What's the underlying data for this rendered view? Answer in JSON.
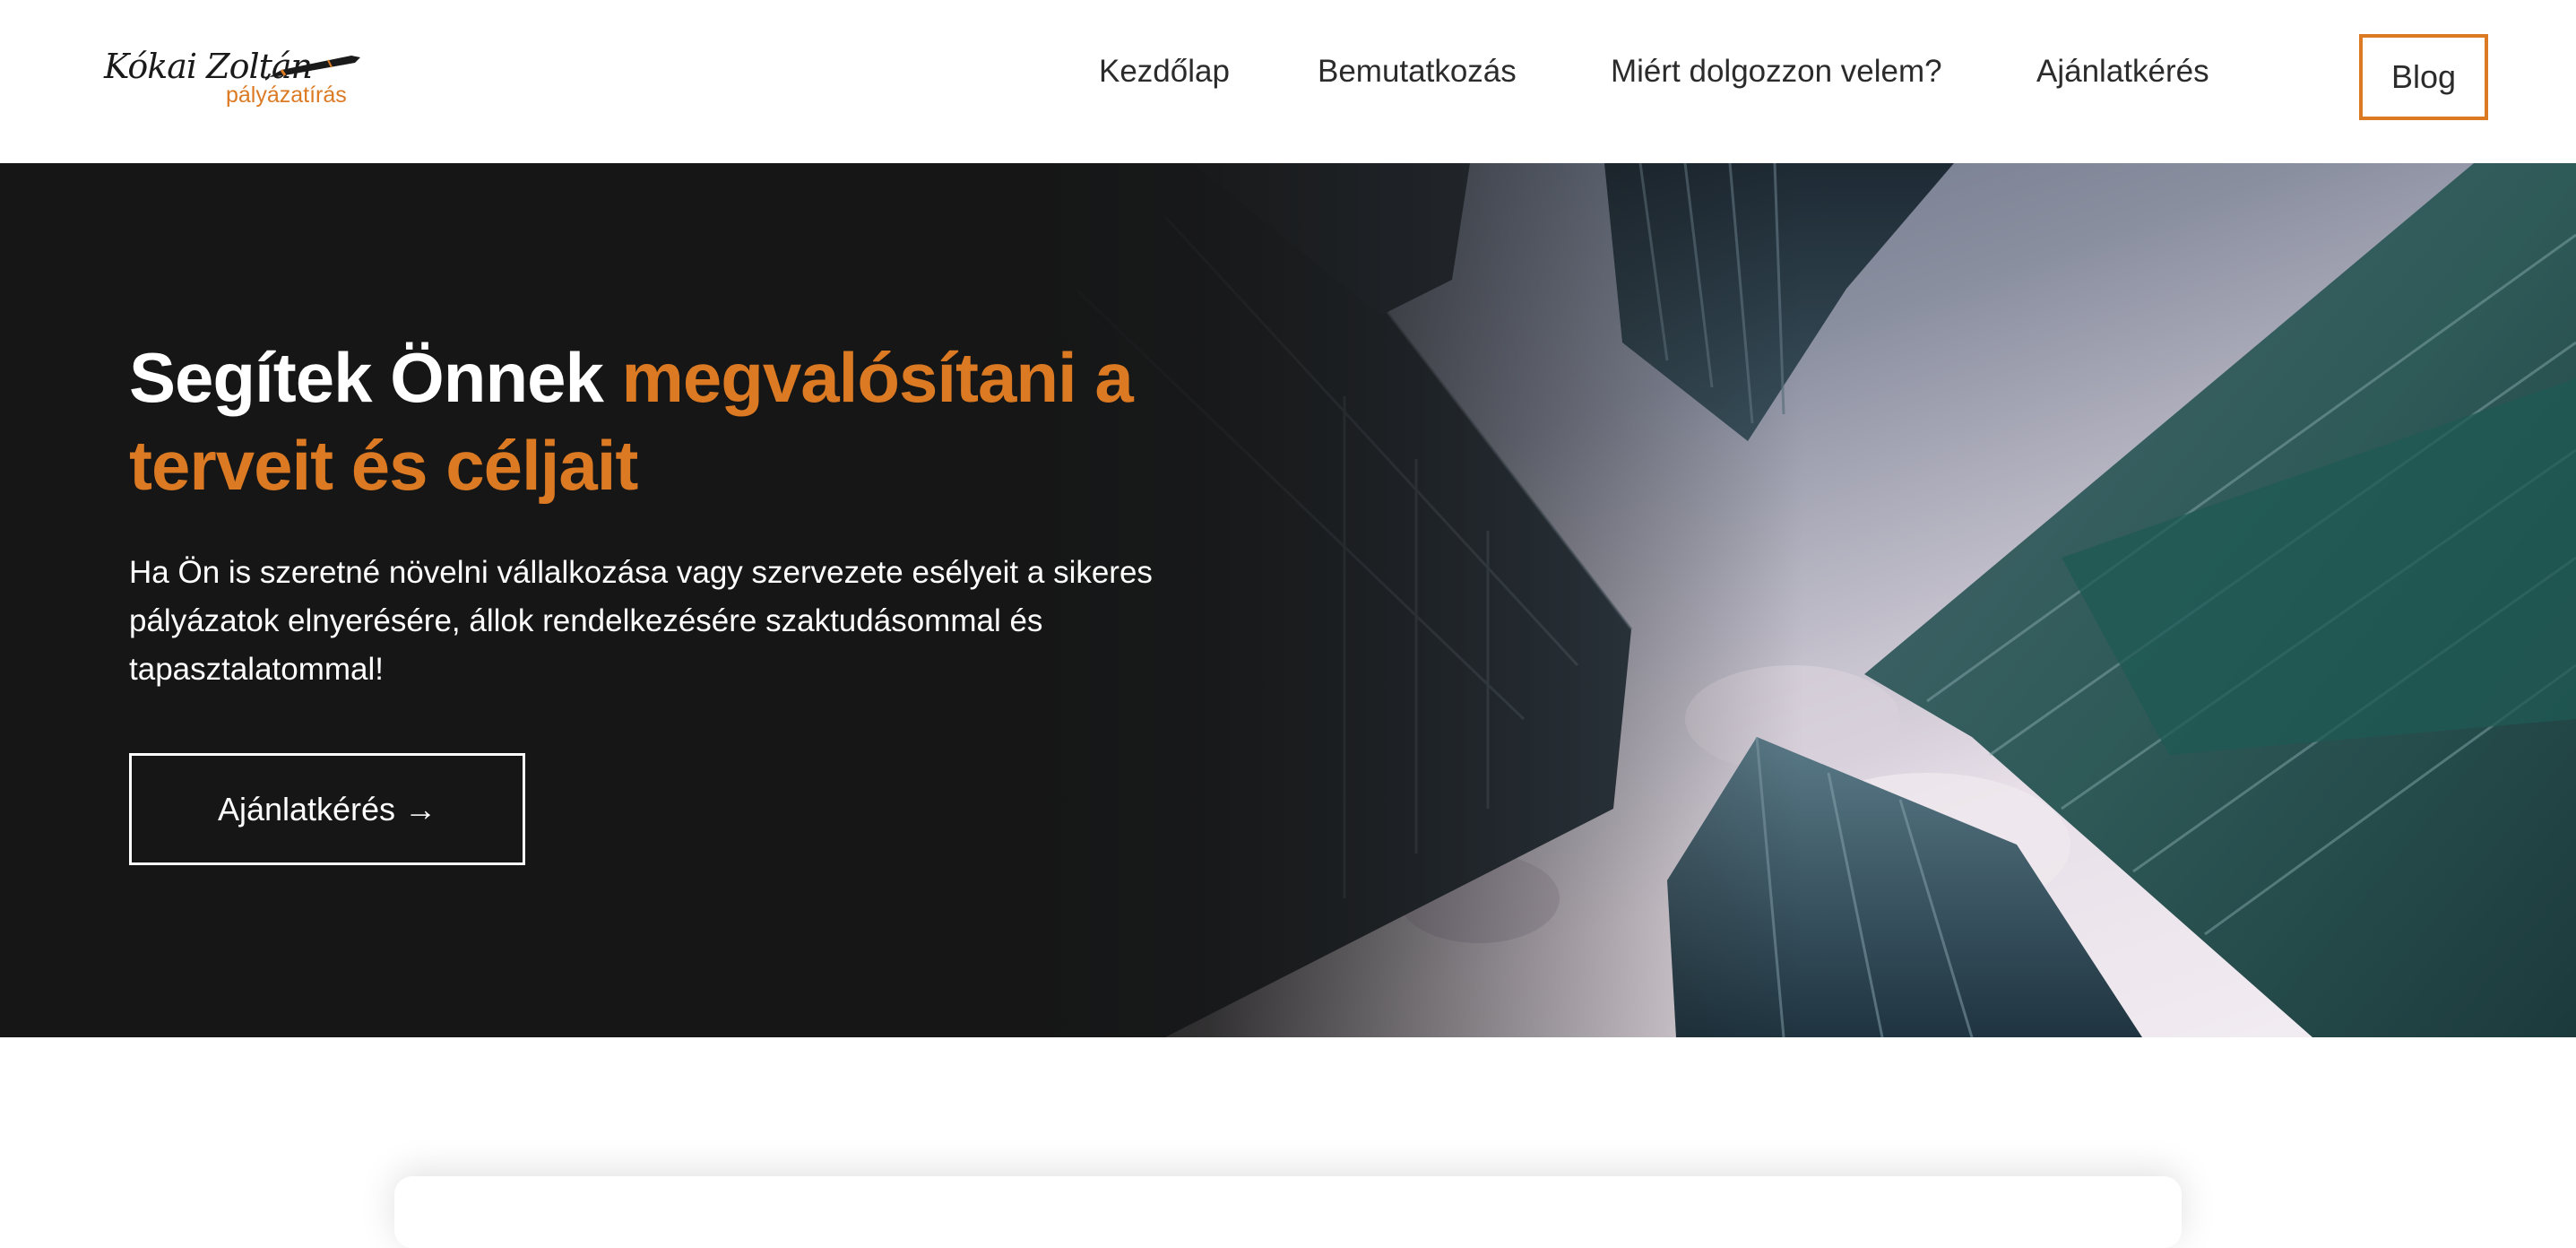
{
  "logo": {
    "name": "Kókai Zoltán",
    "subtitle": "pályázatírás"
  },
  "nav": {
    "items": [
      {
        "label": "Kezdőlap"
      },
      {
        "label": "Bemutatkozás"
      },
      {
        "label": "Miért dolgozzon velem?"
      },
      {
        "label": "Ajánlatkérés"
      }
    ],
    "blog_label": "Blog"
  },
  "hero": {
    "title_white": "Segítek Önnek ",
    "title_accent": "megvalósítani a terveit és céljait",
    "text": "Ha Ön is szeretné növelni vállalkozása vagy szervezete esélyeit a sikeres pályázatok elnyerésére, állok rendelkezésére szaktudásommal és tapasztalatommal!",
    "cta_label": "Ajánlatkérés →"
  },
  "colors": {
    "accent": "#dc7a23",
    "hero_bg": "#161616",
    "text_dark": "#2b2b2b"
  }
}
